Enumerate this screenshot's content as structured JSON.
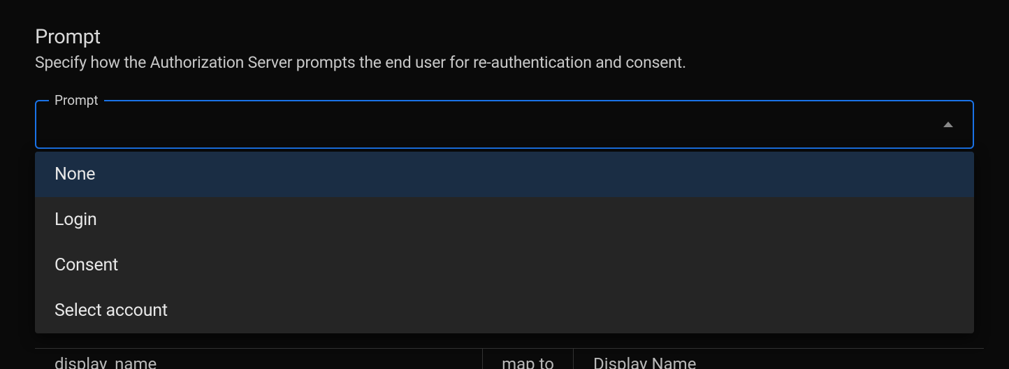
{
  "section": {
    "title": "Prompt",
    "description": "Specify how the Authorization Server prompts the end user for re-authentication and consent."
  },
  "select": {
    "float_label": "Prompt",
    "value": "",
    "options": [
      {
        "label": "None",
        "highlighted": true
      },
      {
        "label": "Login",
        "highlighted": false
      },
      {
        "label": "Consent",
        "highlighted": false
      },
      {
        "label": "Select account",
        "highlighted": false
      }
    ]
  },
  "bg_row": {
    "col1": "display_name",
    "col2": "map to",
    "col3": "Display Name"
  }
}
